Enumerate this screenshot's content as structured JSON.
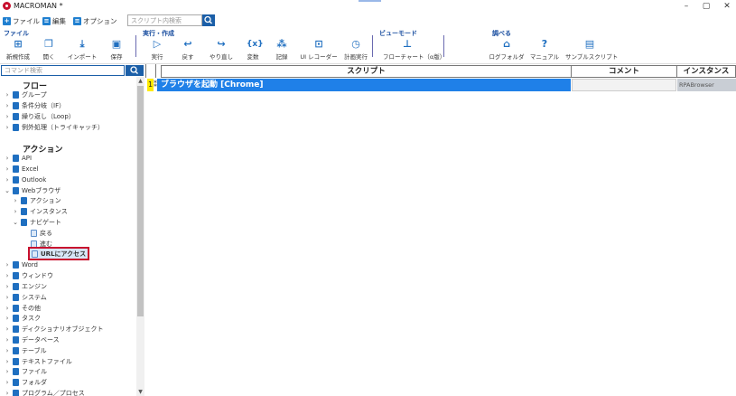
{
  "window": {
    "title": "MACROMAN *"
  },
  "menubar": {
    "items": [
      {
        "label": "ファイル",
        "icon": "plus-file-icon"
      },
      {
        "label": "編集",
        "icon": "edit-icon"
      },
      {
        "label": "オプション",
        "icon": "options-icon"
      }
    ],
    "search_placeholder": "スクリプト内検索"
  },
  "ribbon": {
    "groups": [
      {
        "label": "ファイル"
      },
      {
        "label": "実行・作成"
      },
      {
        "label": "ビューモード"
      },
      {
        "label": "調べる"
      }
    ],
    "buttons": [
      {
        "label": "新規作成",
        "icon": "new-icon"
      },
      {
        "label": "開く",
        "icon": "open-icon"
      },
      {
        "label": "インポート",
        "icon": "import-icon"
      },
      {
        "label": "保存",
        "icon": "save-icon"
      },
      {
        "label": "実行",
        "icon": "play-icon"
      },
      {
        "label": "戻す",
        "icon": "undo-icon"
      },
      {
        "label": "やり直し",
        "icon": "redo-icon"
      },
      {
        "label": "変数",
        "icon": "variable-icon"
      },
      {
        "label": "記録",
        "icon": "record-icon"
      },
      {
        "label": "UI レコーダー",
        "icon": "ui-recorder-icon"
      },
      {
        "label": "計画実行",
        "icon": "schedule-icon"
      },
      {
        "label": "フローチャート（α版）",
        "icon": "flowchart-icon"
      },
      {
        "label": "ログフォルダ",
        "icon": "log-folder-icon"
      },
      {
        "label": "マニュアル",
        "icon": "help-icon"
      },
      {
        "label": "サンプルスクリプト",
        "icon": "sample-script-icon"
      }
    ]
  },
  "left_panel": {
    "search_placeholder": "コマンド検索",
    "flow_header": "フロー",
    "flow_items": [
      "グループ",
      "条件分岐（IF）",
      "繰り返し（Loop）",
      "例外処理（トライキャッチ）"
    ],
    "action_header": "アクション",
    "action_items_top": [
      "API",
      "Excel",
      "Outlook",
      "Webブラウザ"
    ],
    "web_children": [
      "アクション",
      "インスタンス",
      "ナビゲート"
    ],
    "navigate_children": [
      "戻る",
      "進む",
      "URLにアクセス"
    ],
    "action_items_rest": [
      "Word",
      "ウィンドウ",
      "エンジン",
      "システム",
      "その他",
      "タスク",
      "ディクショナリオブジェクト",
      "データベース",
      "テーブル",
      "テキストファイル",
      "ファイル",
      "フォルダ",
      "プログラム／プロセス"
    ]
  },
  "grid": {
    "headers": {
      "script": "スクリプト",
      "comment": "コメント",
      "instance": "インスタンス"
    },
    "rows": [
      {
        "num": "1",
        "script": "ブラウザを起動 [Chrome]",
        "comment": "",
        "instance": "RPABrowser"
      }
    ]
  }
}
